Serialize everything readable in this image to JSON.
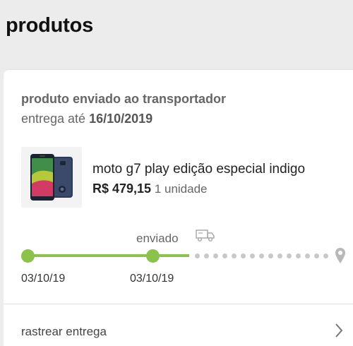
{
  "header": {
    "title": "produtos"
  },
  "order": {
    "status": "produto enviado ao transportador",
    "delivery_prefix": "entrega até",
    "delivery_date": "16/10/2019",
    "product": {
      "name": "moto g7 play edição especial indigo",
      "price": "R$ 479,15",
      "quantity": "1 unidade",
      "image_icon": "phone-product-image"
    },
    "tracking": {
      "current_step_label": "enviado",
      "step1_date": "03/10/19",
      "step2_date": "03/10/19",
      "progress_color": "#8bc34a",
      "pending_color": "#c8c8c8",
      "truck_icon": "truck-icon",
      "destination_icon": "location-pin-icon"
    },
    "track_link": "rastrear entrega"
  }
}
